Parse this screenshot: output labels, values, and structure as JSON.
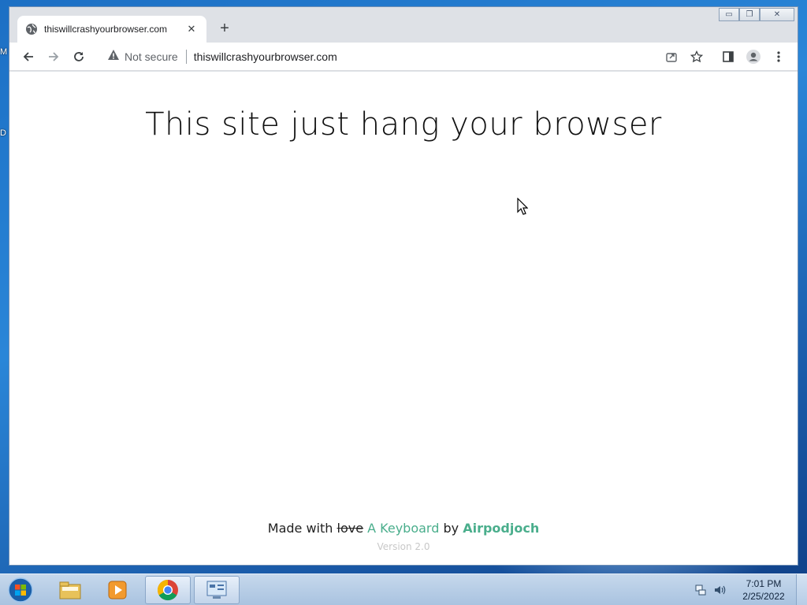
{
  "desktop": {
    "edge_labels": [
      "M",
      "D"
    ]
  },
  "browser": {
    "tab": {
      "title": "thiswillcrashyourbrowser.com",
      "favicon": "globe-icon",
      "close": "✕"
    },
    "new_tab": "+",
    "window_controls": {
      "minimize": "▭",
      "restore": "❐",
      "close": "✕"
    },
    "toolbar": {
      "security_label": "Not secure",
      "url": "thiswillcrashyourbrowser.com"
    }
  },
  "page": {
    "headline": "This site just hang your browser",
    "footer": {
      "made_with": "Made with",
      "struck_word": "love",
      "tool": "A Keyboard",
      "by": "by",
      "author": "Airpodjoch",
      "version": "Version 2.0"
    },
    "accent_color": "#4aae8c"
  },
  "taskbar": {
    "apps": [
      "windows-explorer",
      "media-player",
      "chrome",
      "control-panel"
    ],
    "clock": {
      "time": "7:01 PM",
      "date": "2/25/2022"
    }
  }
}
